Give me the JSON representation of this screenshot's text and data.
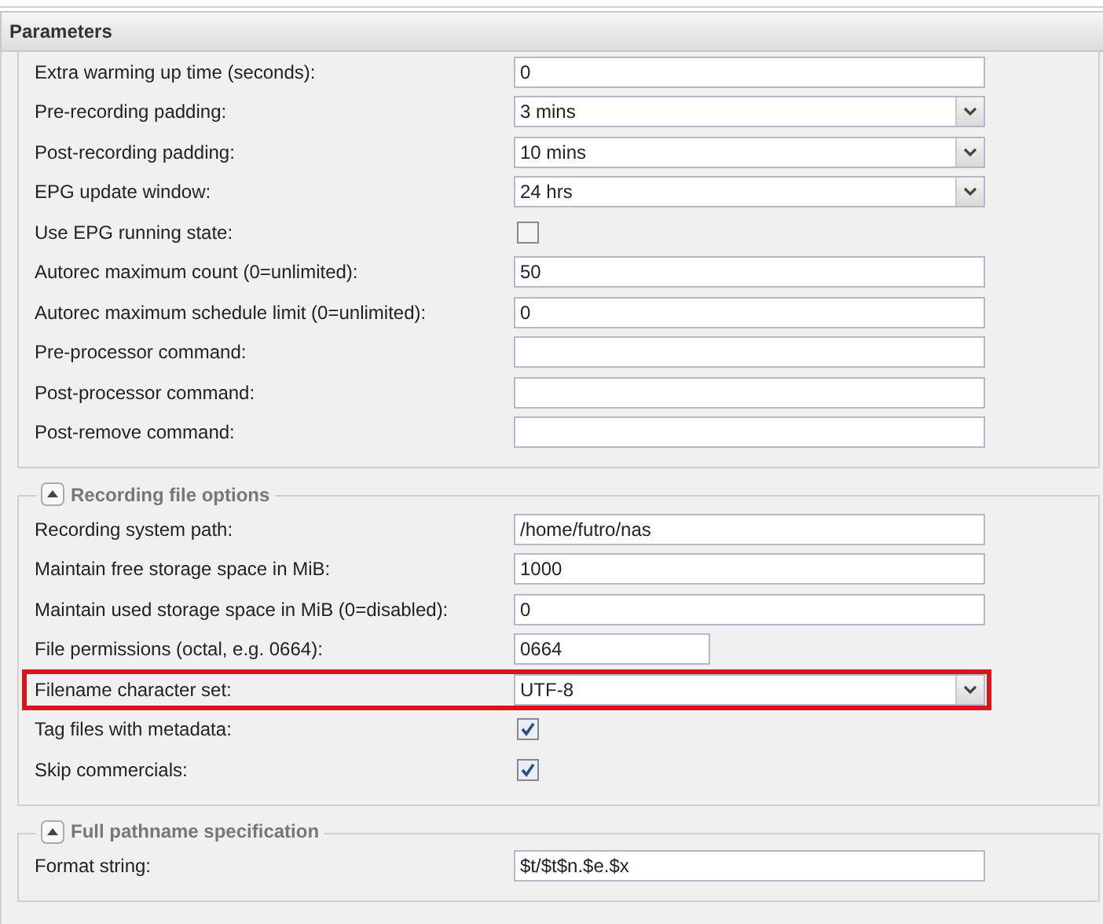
{
  "panel": {
    "title": "Parameters"
  },
  "sections": [
    {
      "rows": [
        {
          "kind": "text",
          "label": "Extra warming up time (seconds):",
          "value": "0"
        },
        {
          "kind": "select",
          "label": "Pre-recording padding:",
          "value": "3 mins"
        },
        {
          "kind": "select",
          "label": "Post-recording padding:",
          "value": "10 mins"
        },
        {
          "kind": "select",
          "label": "EPG update window:",
          "value": "24 hrs"
        },
        {
          "kind": "checkbox",
          "label": "Use EPG running state:",
          "checked": false
        },
        {
          "kind": "text",
          "label": "Autorec maximum count (0=unlimited):",
          "value": "50"
        },
        {
          "kind": "text",
          "label": "Autorec maximum schedule limit (0=unlimited):",
          "value": "0"
        },
        {
          "kind": "text",
          "label": "Pre-processor command:"
        },
        {
          "kind": "text",
          "label": "Post-processor command:"
        },
        {
          "kind": "text",
          "label": "Post-remove command:"
        }
      ]
    },
    {
      "legend": "Recording file options",
      "rows": [
        {
          "kind": "text",
          "label": "Recording system path:",
          "value": "/home/futro/nas"
        },
        {
          "kind": "text",
          "label": "Maintain free storage space in MiB:",
          "value": "1000"
        },
        {
          "kind": "text",
          "label": "Maintain used storage space in MiB (0=disabled):",
          "value": "0"
        },
        {
          "kind": "short-text",
          "label": "File permissions (octal, e.g. 0664):",
          "value": "0664"
        },
        {
          "kind": "select",
          "label": "Filename character set:",
          "value": "UTF-8",
          "highlighted": true
        },
        {
          "kind": "checkbox",
          "label": "Tag files with metadata:",
          "checked": true
        },
        {
          "kind": "checkbox",
          "label": "Skip commercials:",
          "checked": true
        }
      ]
    },
    {
      "legend": "Full pathname specification",
      "rows": [
        {
          "kind": "text",
          "label": "Format string:",
          "value": "$t/$t$n.$e.$x"
        }
      ]
    }
  ]
}
